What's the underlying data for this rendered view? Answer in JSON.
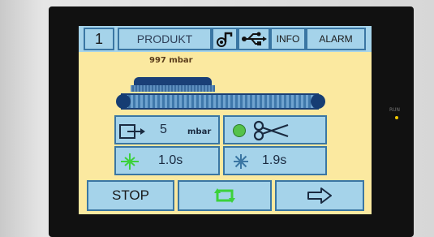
{
  "header": {
    "program_number": "1",
    "product_label": "PRODUKT",
    "info_label": "INFO",
    "alarm_label": "ALARM"
  },
  "icons": {
    "sound": "speaker-music-icon",
    "usb": "usb-icon",
    "exit": "arrow-exit-icon",
    "cut": "scissors-icon",
    "weld": "sealing-time-icon",
    "cool": "cooling-snowflake-icon",
    "cycle": "cycle-icon",
    "next": "arrow-right-icon"
  },
  "pressure": "997 mbar",
  "cells": {
    "vacuum_value": "5",
    "vacuum_unit": "mbar",
    "seal_time": "1.0s",
    "cool_time": "1.9s"
  },
  "footer": {
    "stop_label": "STOP"
  },
  "status": {
    "indicator_color": "#55c24a",
    "run_label": "RUN"
  },
  "colors": {
    "screen_bg": "#fbe9a0",
    "button_fill": "#a5d3ea",
    "button_border": "#3a76a3",
    "icon_green": "#3bd13b",
    "conveyor": "#1a3f77"
  }
}
